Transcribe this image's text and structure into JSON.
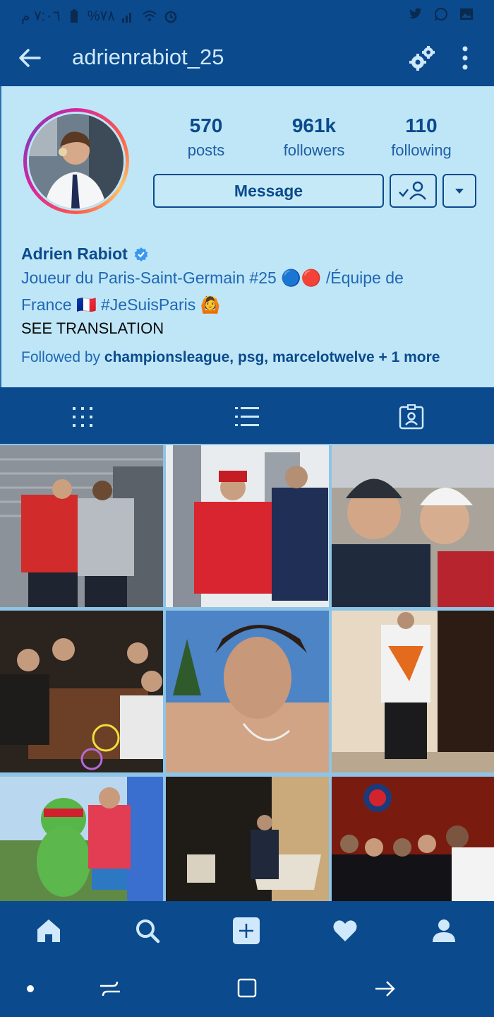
{
  "status_bar": {
    "time": "٧:٠٦ م",
    "battery": "%٧٨",
    "icons_left": [
      "battery-icon",
      "signal-icon",
      "wifi-icon",
      "alarm-icon"
    ],
    "icons_right": [
      "twitter-icon",
      "whatsapp-icon",
      "gallery-icon"
    ]
  },
  "header": {
    "username": "adrienrabiot_25",
    "icons": [
      "back-arrow-icon",
      "gear-icon",
      "more-vertical-icon"
    ]
  },
  "profile": {
    "stats": [
      {
        "value": "570",
        "label": "posts"
      },
      {
        "value": "961k",
        "label": "followers"
      },
      {
        "value": "110",
        "label": "following"
      }
    ],
    "message_label": "Message",
    "full_name": "Adrien Rabiot",
    "bio_line1": "Joueur du Paris-Saint-Germain #25 🔵🔴 /Équipe de",
    "bio_line2": "France 🇫🇷 #JeSuisParis 🙆",
    "see_translation": "SEE TRANSLATION",
    "followed_by_prefix": "Followed by ",
    "followed_by_names": "championsleague, psg, marcelotwelve + 1 more"
  },
  "tabs": [
    "grid-icon",
    "list-icon",
    "tagged-icon"
  ],
  "bottom_nav": [
    "home-icon",
    "search-icon",
    "add-icon",
    "heart-icon",
    "profile-icon"
  ],
  "colors": {
    "bar": "#0b4a8c",
    "profile_bg": "#bfe6f7",
    "accent": "#0b4a8c",
    "link": "#1f68b4",
    "verified": "#3897f0"
  }
}
